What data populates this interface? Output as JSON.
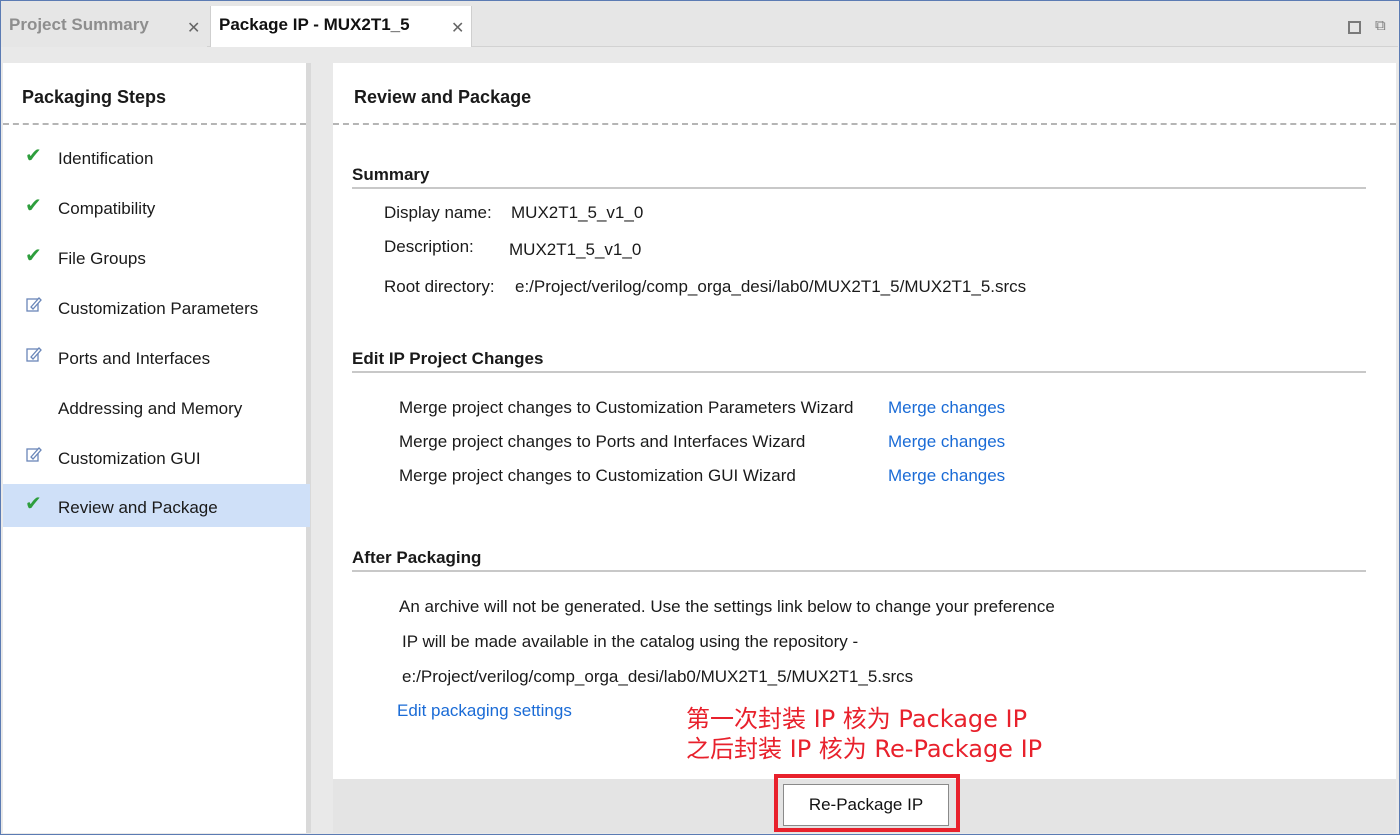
{
  "tabs": [
    {
      "label": "Project Summary",
      "close": "✕"
    },
    {
      "label": "Package IP - MUX2T1_5",
      "close": "✕"
    }
  ],
  "left_panel": {
    "title": "Packaging Steps",
    "steps": [
      {
        "label": "Identification",
        "icon": "check-icon",
        "status": "✔"
      },
      {
        "label": "Compatibility",
        "icon": "check-icon",
        "status": "✔"
      },
      {
        "label": "File Groups",
        "icon": "check-icon",
        "status": "✔"
      },
      {
        "label": "Customization Parameters",
        "icon": "edit-icon",
        "status": ""
      },
      {
        "label": "Ports and Interfaces",
        "icon": "edit-icon",
        "status": ""
      },
      {
        "label": "Addressing and Memory",
        "icon": "",
        "status": ""
      },
      {
        "label": "Customization GUI",
        "icon": "edit-icon",
        "status": ""
      },
      {
        "label": "Review and Package",
        "icon": "check-icon",
        "status": "✔",
        "selected": true
      }
    ]
  },
  "right_panel": {
    "title": "Review and Package",
    "summary": {
      "title": "Summary",
      "display_name_label": "Display name:",
      "display_name": "MUX2T1_5_v1_0",
      "description_label": "Description:",
      "description": "MUX2T1_5_v1_0",
      "root_dir_label": "Root directory:",
      "root_dir": "e:/Project/verilog/comp_orga_desi/lab0/MUX2T1_5/MUX2T1_5.srcs"
    },
    "edit_changes": {
      "title": "Edit IP Project Changes",
      "rows": [
        {
          "text": "Merge project changes to Customization Parameters Wizard",
          "link": "Merge changes"
        },
        {
          "text": "Merge project changes to Ports and Interfaces Wizard",
          "link": "Merge changes"
        },
        {
          "text": "Merge project changes to Customization GUI Wizard",
          "link": "Merge changes"
        }
      ]
    },
    "after_packaging": {
      "title": "After Packaging",
      "line1": "An archive will not be generated. Use the settings link below to change your preference",
      "line2": "IP will be made available in the catalog using the repository -",
      "line3": "e:/Project/verilog/comp_orga_desi/lab0/MUX2T1_5/MUX2T1_5.srcs",
      "settings_link": "Edit packaging settings"
    }
  },
  "annotation": {
    "line1": "第一次封装 IP 核为 Package IP",
    "line2": "之后封装 IP 核为 Re-Package IP",
    "color": "#e8212c"
  },
  "repackage_button": "Re-Package IP"
}
